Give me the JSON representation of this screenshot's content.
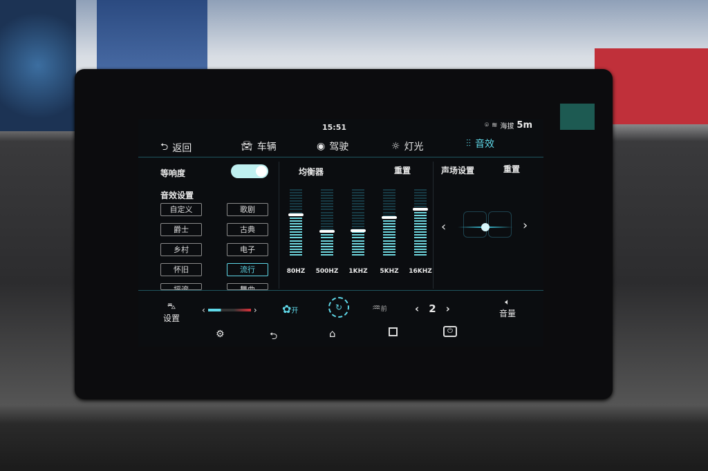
{
  "status": {
    "time": "15:51",
    "altitude_label": "海拔",
    "altitude_value": "5m",
    "icons": [
      "location-icon",
      "wifi-icon"
    ]
  },
  "tabs": [
    {
      "label": "返回",
      "icon": "back-icon"
    },
    {
      "label": "车辆",
      "icon": "car-icon"
    },
    {
      "label": "驾驶",
      "icon": "steering-wheel-icon"
    },
    {
      "label": "灯光",
      "icon": "light-icon"
    },
    {
      "label": "音效",
      "icon": "equalizer-icon",
      "active": true
    }
  ],
  "loudness": {
    "label": "等响度",
    "enabled": true
  },
  "sound_presets": {
    "title": "音效设置",
    "items": [
      "自定义",
      "歌剧",
      "爵士",
      "古典",
      "乡村",
      "电子",
      "怀旧",
      "流行",
      "摇滚",
      "舞曲"
    ],
    "selected": "流行"
  },
  "equalizer": {
    "title": "均衡器",
    "reset": "重置",
    "bands": [
      {
        "label": "80HZ",
        "level": 0.57
      },
      {
        "label": "500HZ",
        "level": 0.33
      },
      {
        "label": "1KHZ",
        "level": 0.34
      },
      {
        "label": "5KHZ",
        "level": 0.53
      },
      {
        "label": "16KHZ",
        "level": 0.65
      }
    ]
  },
  "sound_field": {
    "title": "声场设置",
    "reset": "重置",
    "balance": 0.5
  },
  "climate": {
    "settings_label": "设置",
    "fan_on_label": "开",
    "defrost_label": "前",
    "fan_speed": "2",
    "volume_label": "音量"
  },
  "colors": {
    "accent": "#5fd8e8",
    "background": "#0b0d10"
  }
}
